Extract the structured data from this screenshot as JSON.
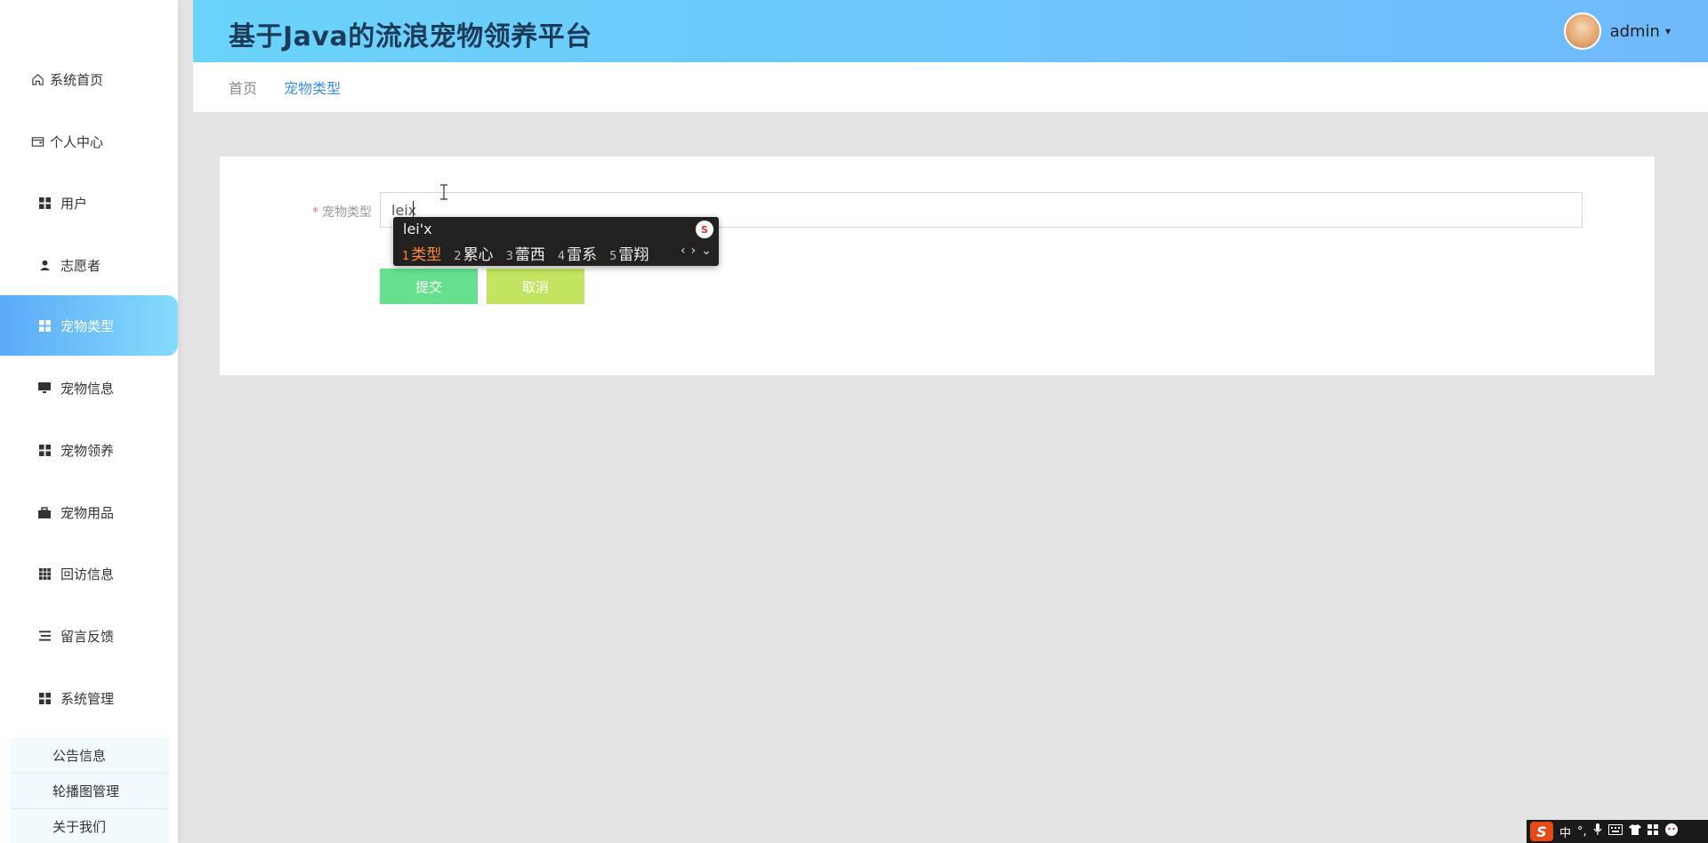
{
  "sidebar": {
    "items": [
      {
        "label": "系统首页",
        "icon": "home-icon"
      },
      {
        "label": "个人中心",
        "icon": "wallet-icon"
      },
      {
        "label": "用户",
        "icon": "grid-icon"
      },
      {
        "label": "志愿者",
        "icon": "person-icon"
      },
      {
        "label": "宠物类型",
        "icon": "grid-icon",
        "active": true
      },
      {
        "label": "宠物信息",
        "icon": "monitor-icon"
      },
      {
        "label": "宠物领养",
        "icon": "grid-icon"
      },
      {
        "label": "宠物用品",
        "icon": "briefcase-icon"
      },
      {
        "label": "回访信息",
        "icon": "grid9-icon"
      },
      {
        "label": "留言反馈",
        "icon": "list-icon"
      },
      {
        "label": "系统管理",
        "icon": "grid-icon"
      }
    ],
    "sub_items": [
      {
        "label": "公告信息"
      },
      {
        "label": "轮播图管理"
      },
      {
        "label": "关于我们"
      }
    ]
  },
  "header": {
    "title": "基于Java的流浪宠物领养平台",
    "username": "admin",
    "caret": "▾"
  },
  "breadcrumb": {
    "home": "首页",
    "current": "宠物类型"
  },
  "form": {
    "required_mark": "*",
    "field_label": "宠物类型",
    "field_value": "leix",
    "submit_label": "提交",
    "cancel_label": "取消"
  },
  "ime": {
    "composition": "lei'x",
    "logo": "S",
    "candidates": [
      {
        "num": "1",
        "text": "类型"
      },
      {
        "num": "2",
        "text": "累心"
      },
      {
        "num": "3",
        "text": "蕾西"
      },
      {
        "num": "4",
        "text": "雷系"
      },
      {
        "num": "5",
        "text": "雷翔"
      }
    ],
    "prev": "‹",
    "next": "›",
    "expand": "⌄"
  },
  "tray": {
    "logo": "S",
    "lang": "中",
    "punct": "°,"
  },
  "colors": {
    "accent": "#5aaaf7",
    "submit": "#66e08e",
    "cancel": "#c3e461",
    "required": "#f56c6c",
    "ime_selected": "#ff8a3c"
  }
}
